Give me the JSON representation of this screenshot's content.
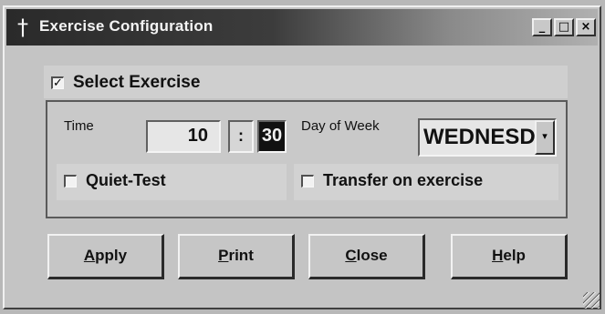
{
  "window": {
    "title": "Exercise Configuration",
    "title_icon": "dagger-icon",
    "controls": {
      "minimize": "_",
      "maximize": "□",
      "close": "×"
    }
  },
  "select_exercise": {
    "label": "Select Exercise",
    "checked": true,
    "mark": "✓"
  },
  "time": {
    "label": "Time",
    "hour": "10",
    "separator": ":",
    "minute": "30"
  },
  "day_of_week": {
    "label": "Day of Week",
    "value": "WEDNESD",
    "arrow": "▾"
  },
  "quiet_test": {
    "label": "Quiet-Test",
    "checked": false
  },
  "transfer_on_exercise": {
    "label": "Transfer on exercise",
    "checked": false
  },
  "buttons": {
    "apply": {
      "first": "A",
      "rest": "pply"
    },
    "print": {
      "first": "P",
      "rest": "rint"
    },
    "close": {
      "first": "C",
      "rest": "lose"
    },
    "help": {
      "first": "H",
      "rest": "elp"
    }
  }
}
